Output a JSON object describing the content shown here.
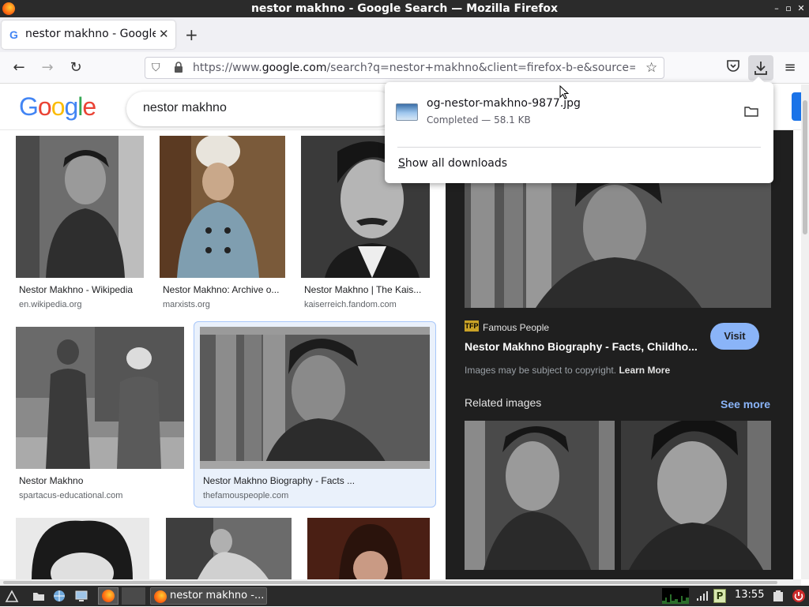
{
  "window": {
    "title": "nestor makhno - Google Search — Mozilla Firefox"
  },
  "tab": {
    "title": "nestor makhno - Google",
    "favicon": "G"
  },
  "navbar": {
    "url_prefix": "https://www.",
    "url_domain": "google.com",
    "url_rest": "/search?q=nestor+makhno&client=firefox-b-e&source="
  },
  "google": {
    "query": "nestor makhno",
    "logo_letters": [
      "G",
      "o",
      "o",
      "g",
      "l",
      "e"
    ],
    "logo_colors": [
      "#4285f4",
      "#ea4335",
      "#fbbc05",
      "#4285f4",
      "#34a853",
      "#ea4335"
    ]
  },
  "results": [
    {
      "caption": "Nestor Makhno - Wikipedia",
      "source": "en.wikipedia.org"
    },
    {
      "caption": "Nestor Makhno: Archive o...",
      "source": "marxists.org"
    },
    {
      "caption": "Nestor Makhno | The Kais...",
      "source": "kaiserreich.fandom.com"
    },
    {
      "caption": "Nestor Makhno",
      "source": "spartacus-educational.com"
    },
    {
      "caption": "Nestor Makhno Biography - Facts ...",
      "source": "thefamouspeople.com"
    }
  ],
  "panel": {
    "source_badge": "TFP",
    "source_name": "Famous People",
    "title": "Nestor Makhno Biography - Facts, Childho...",
    "visit_label": "Visit",
    "copyright_text": "Images may be subject to copyright.",
    "learn_more": "Learn More",
    "related_heading": "Related images",
    "see_more": "See more"
  },
  "downloads": {
    "file_name": "og-nestor-makhno-9877.jpg",
    "status": "Completed — 58.1 KB",
    "show_all_prefix": "S",
    "show_all_rest": "how all downloads"
  },
  "taskbar": {
    "task_label": "nestor makhno -...",
    "clock": "13:55"
  }
}
